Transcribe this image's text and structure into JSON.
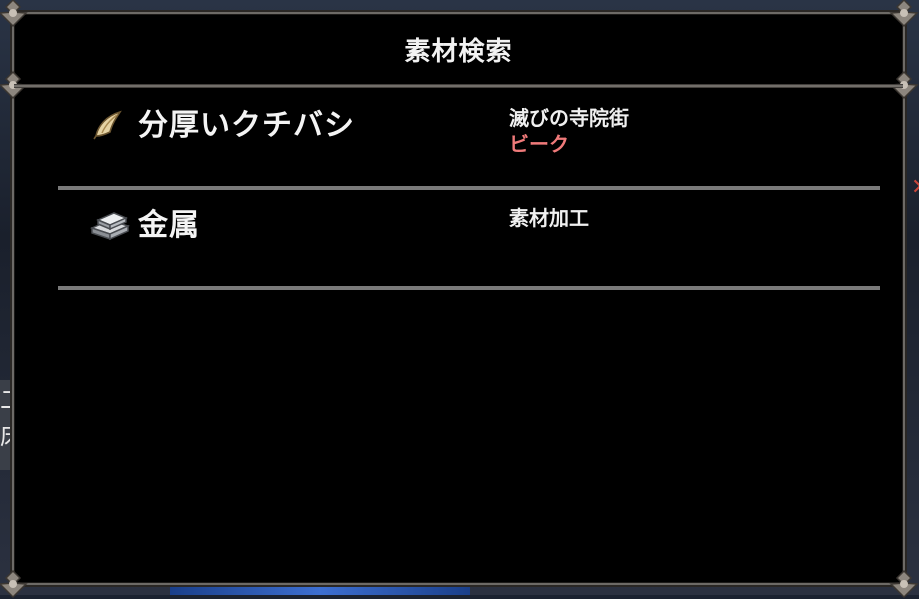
{
  "dialog": {
    "title": "素材検索"
  },
  "materials": [
    {
      "name": "分厚いクチバシ",
      "icon": "beak-icon",
      "source": "滅びの寺院街",
      "sub": "ビーク",
      "sub_color": "#f07a7a"
    },
    {
      "name": "金属",
      "icon": "metal-ingot-icon",
      "source": "素材加工",
      "sub": ""
    }
  ],
  "background": {
    "left_text": "二\n床"
  }
}
